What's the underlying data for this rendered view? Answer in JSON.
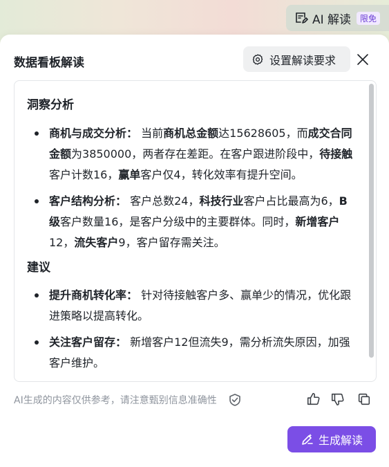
{
  "header": {
    "ai_button_label": "AI 解读",
    "ai_badge": "限免",
    "icon": "ai-doc-icon"
  },
  "panel": {
    "title": "数据看板解读",
    "settings_label": "设置解读要求",
    "settings_icon": "gear-icon",
    "close_icon": "close-icon"
  },
  "content": {
    "section1_title": "洞察分析",
    "section2_title": "建议",
    "insights": [
      {
        "segments": [
          {
            "text": "商机与成交分析：",
            "bold": true
          },
          {
            "text": " 当前",
            "bold": false
          },
          {
            "text": "商机总金额",
            "bold": true
          },
          {
            "text": "达15628605，而",
            "bold": false
          },
          {
            "text": "成交合同金额",
            "bold": true
          },
          {
            "text": "为3850000，两者存在差距。在客户跟进阶段中，",
            "bold": false
          },
          {
            "text": "待接触",
            "bold": true
          },
          {
            "text": "客户计数16，",
            "bold": false
          },
          {
            "text": "赢单",
            "bold": true
          },
          {
            "text": "客户仅4，转化效率有提升空间。",
            "bold": false
          }
        ]
      },
      {
        "segments": [
          {
            "text": "客户结构分析：",
            "bold": true
          },
          {
            "text": " 客户总数24，",
            "bold": false
          },
          {
            "text": "科技行业",
            "bold": true
          },
          {
            "text": "客户占比最高为6，",
            "bold": false
          },
          {
            "text": "B级",
            "bold": true
          },
          {
            "text": "客户数量16，是客户分级中的主要群体。同时，",
            "bold": false
          },
          {
            "text": "新增客户",
            "bold": true
          },
          {
            "text": "12，",
            "bold": false
          },
          {
            "text": "流失客户",
            "bold": true
          },
          {
            "text": "9，客户留存需关注。",
            "bold": false
          }
        ]
      }
    ],
    "suggestions": [
      {
        "segments": [
          {
            "text": "提升商机转化率：",
            "bold": true
          },
          {
            "text": " 针对待接触客户多、赢单少的情况，优化跟进策略以提高转化。",
            "bold": false
          }
        ]
      },
      {
        "segments": [
          {
            "text": "关注客户留存：",
            "bold": true
          },
          {
            "text": " 新增客户12但流失9，需分析流失原因，加强客户维护。",
            "bold": false
          }
        ]
      }
    ]
  },
  "footer": {
    "disclaimer": "AI生成的内容仅供参考，请注意甄别信息准确性",
    "verify_icon": "shield-check-icon",
    "like_icon": "thumbs-up-icon",
    "dislike_icon": "thumbs-down-icon",
    "copy_icon": "copy-icon",
    "generate_label": "生成解读",
    "generate_icon": "sparkle-pen-icon"
  },
  "colors": {
    "accent": "#7b4ee6",
    "badge_text": "#6b3fd4",
    "muted_text": "#8f959e"
  }
}
